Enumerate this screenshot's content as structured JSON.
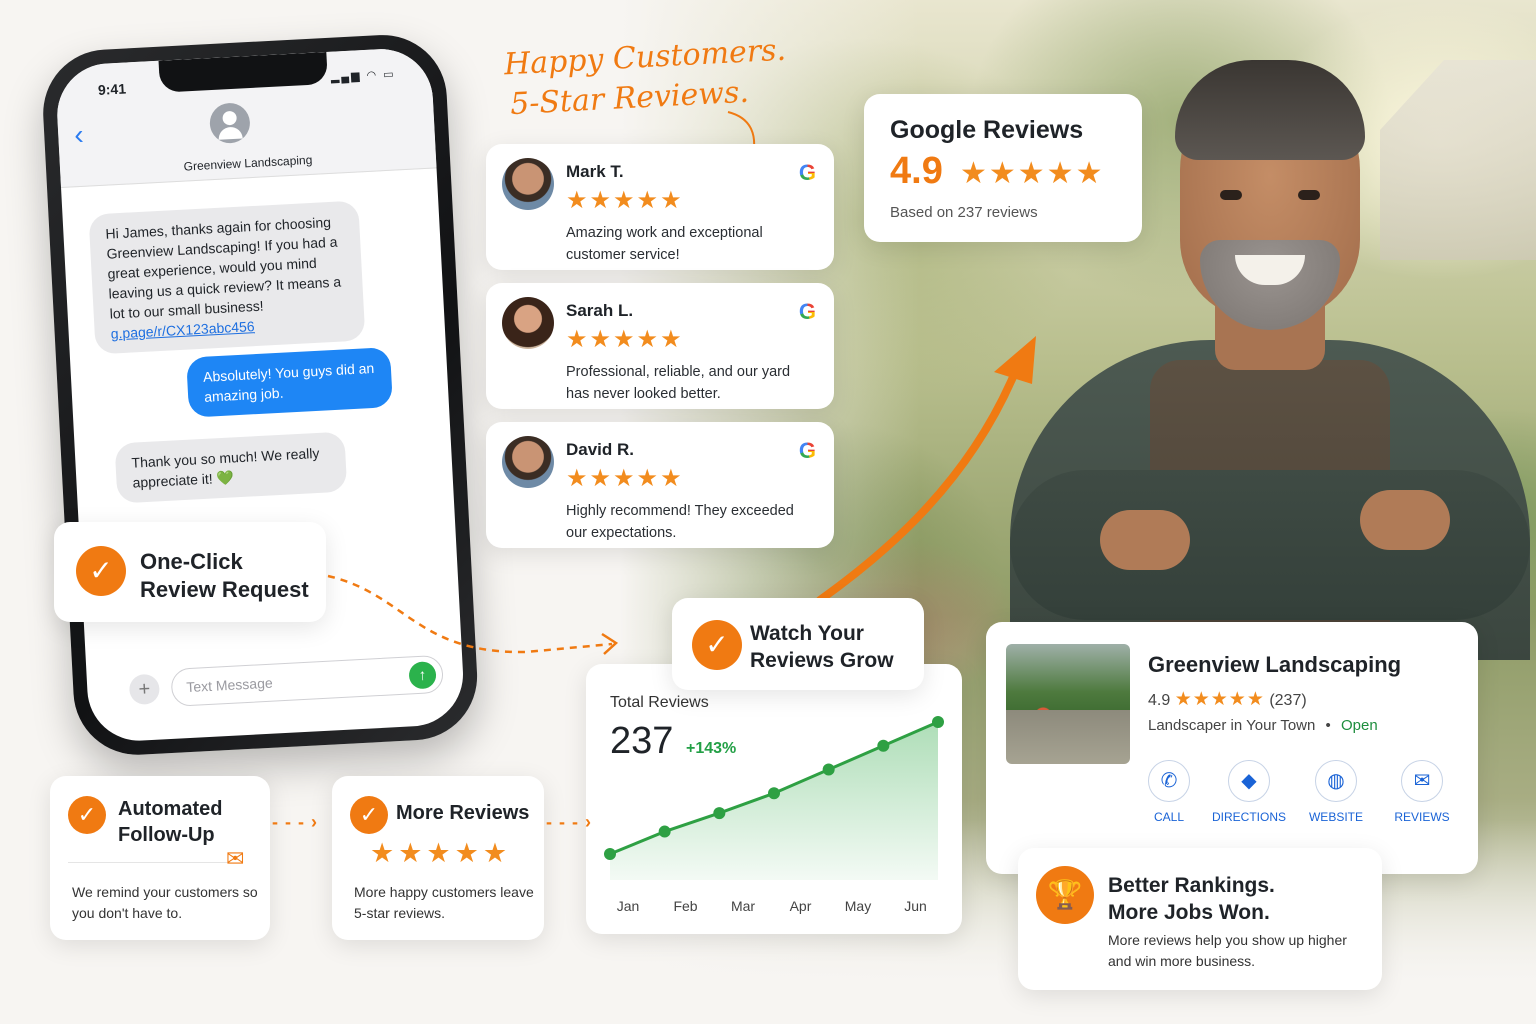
{
  "headline": {
    "line1": "Happy Customers.",
    "line2": "5-Star Reviews."
  },
  "phone": {
    "time": "9:41",
    "contact_name": "Greenview Landscaping",
    "messages": [
      {
        "dir": "in",
        "text": "Hi James, thanks again for choosing Greenview Landscaping! If you had a great experience, would you mind leaving us a quick review? It means a lot to our small business!",
        "link": "g.page/r/CX123abc456"
      },
      {
        "dir": "out",
        "text": "Absolutely! You guys did an amazing job."
      },
      {
        "dir": "in",
        "text": "Thank you so much! We really appreciate it! 💚"
      }
    ],
    "composer_placeholder": "Text Message"
  },
  "reviews": [
    {
      "name": "Mark T.",
      "stars": "★★★★★",
      "text": "Amazing work and exceptional customer service!"
    },
    {
      "name": "Sarah L.",
      "stars": "★★★★★",
      "text": "Professional, reliable, and our yard has never looked better."
    },
    {
      "name": "David R.",
      "stars": "★★★★★",
      "text": "Highly recommend! They exceeded our expectations."
    }
  ],
  "google_summary": {
    "title": "Google Reviews",
    "rating": "4.9",
    "stars": "★★★★★",
    "based_on": "Based on 237 reviews"
  },
  "features": {
    "one_click": "One-Click Review Request",
    "watch": "Watch Your Reviews Grow",
    "automated": {
      "title": "Automated Follow-Up",
      "desc": "We remind your customers so you don't have to."
    },
    "more": {
      "title": "More Reviews",
      "stars": "★★★★★",
      "desc": "More happy customers leave 5-star reviews."
    }
  },
  "chart_data": {
    "type": "area",
    "title": "Total Reviews",
    "total": "237",
    "growth": "+143%",
    "categories": [
      "Jan",
      "Feb",
      "Mar",
      "Apr",
      "May",
      "Jun"
    ],
    "series": [
      {
        "values": [
          0.0,
          0.17,
          0.31,
          0.46,
          0.64,
          0.82,
          1.0
        ]
      }
    ],
    "note_on_values": "",
    "color": "#2ea043"
  },
  "business": {
    "name": "Greenview Landscaping",
    "rating": "4.9",
    "stars": "★★★★★",
    "count": "(237)",
    "category": "Landscaper in Your Town",
    "separator": "•",
    "status": "Open",
    "actions": [
      {
        "label": "CALL",
        "icon": "phone-icon"
      },
      {
        "label": "DIRECTIONS",
        "icon": "directions-icon"
      },
      {
        "label": "WEBSITE",
        "icon": "globe-icon"
      },
      {
        "label": "REVIEWS",
        "icon": "message-icon"
      }
    ]
  },
  "rankings": {
    "title": "Better Rankings. More Jobs Won.",
    "desc": "More reviews help you show up higher and win more business."
  },
  "colors": {
    "accent": "#f07a12",
    "link": "#1a63d6",
    "bubble_out": "#1e86f5",
    "chart_green": "#2ea043"
  }
}
